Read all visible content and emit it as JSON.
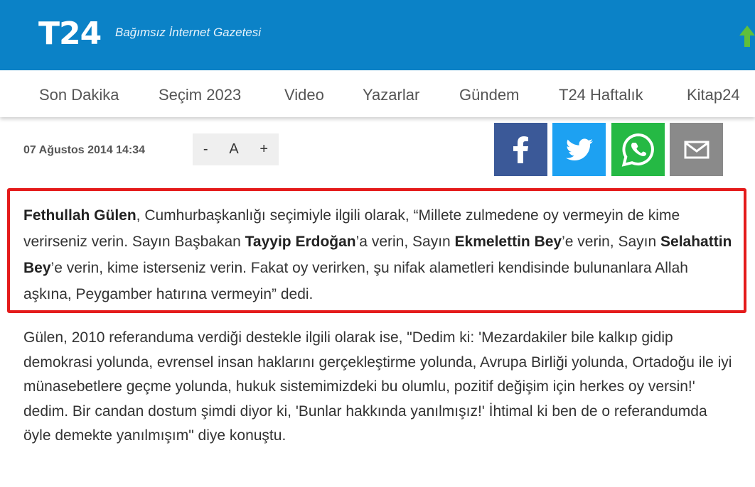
{
  "header": {
    "logo_text": "T24",
    "tagline": "Bağımsız İnternet Gazetesi",
    "brand_color": "#0b82c7"
  },
  "nav": {
    "items": [
      "Son Dakika",
      "Seçim 2023",
      "Video",
      "Yazarlar",
      "Gündem",
      "T24 Haftalık",
      "Kitap24"
    ]
  },
  "article": {
    "date": "07 Ağustos 2014 14:34",
    "font_controls": {
      "decrease": "-",
      "reset": "A",
      "increase": "+"
    },
    "share": {
      "facebook_icon": "facebook-icon",
      "twitter_icon": "twitter-icon",
      "whatsapp_icon": "whatsapp-icon",
      "mail_icon": "mail-icon"
    },
    "paragraph1": {
      "s1_bold": "Fethullah Gülen",
      "s1_text": ", Cumhurbaşkanlığı seçimiyle ilgili olarak, “Millete zulmedene oy vermeyin de kime verirseniz verin. Sayın Başbakan ",
      "s2_bold": "Tayyip Erdoğan",
      "s2_text": "’a verin, Sayın ",
      "s3_bold": "Ekmelettin Bey",
      "s3_text": "’e verin, Sayın ",
      "s4_bold": "Selahattin Bey",
      "s4_text": "’e verin, kime isterseniz verin. Fakat oy verirken, şu nifak alametleri kendisinde bulunanlara Allah aşkına, Peygamber hatırına vermeyin” dedi."
    },
    "paragraph2": "Gülen, 2010 referanduma verdiği destekle ilgili olarak ise, \"Dedim ki: 'Mezardakiler bile kalkıp gidip demokrasi yolunda, evrensel insan haklarını gerçekleştirme yolunda, Avrupa Birliği yolunda, Ortadoğu ile iyi münasebetlere geçme yolunda, hukuk sistemimizdeki bu olumlu, pozitif değişim için herkes oy versin!' dedim. Bir candan dostum şimdi diyor ki, 'Bunlar hakkında yanılmışız!' İhtimal ki ben de o referandumda öyle demekte yanılmışım\" diye konuştu.",
    "highlight_color": "#e41b1b"
  }
}
